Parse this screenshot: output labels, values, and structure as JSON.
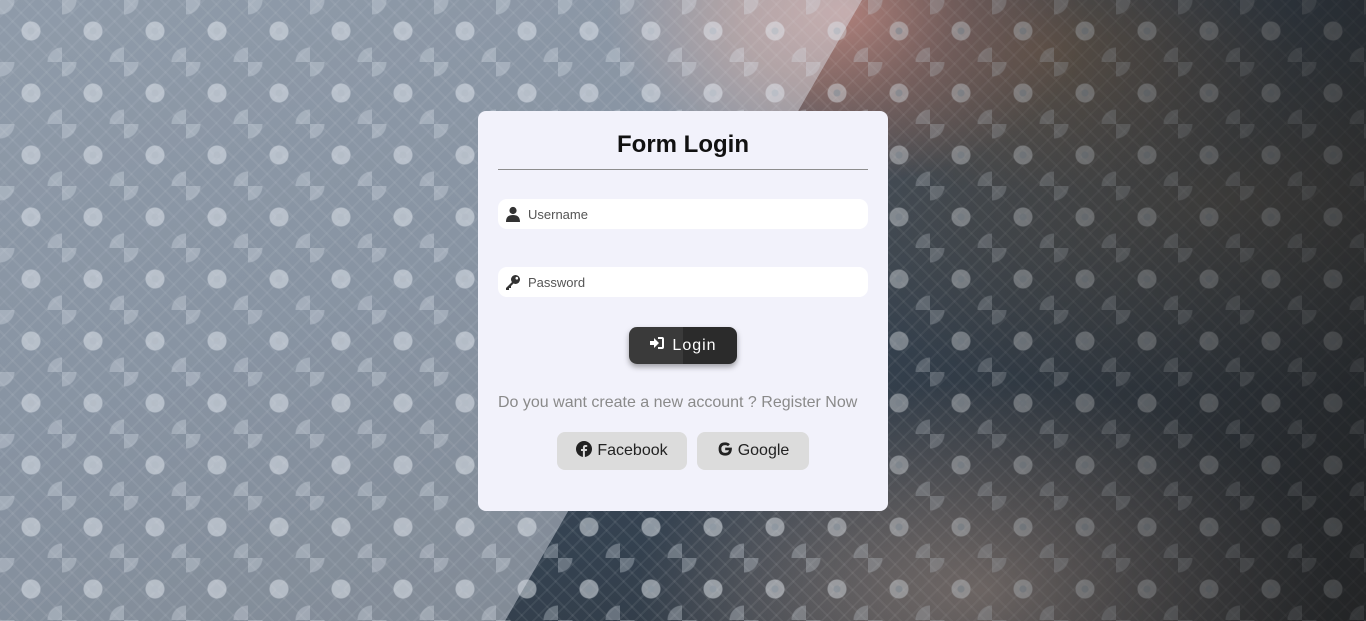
{
  "form": {
    "title": "Form Login",
    "username_placeholder": "Username",
    "password_placeholder": "Password",
    "login_label": "Login",
    "register_prompt": "Do you want create a new account ?",
    "register_link": "Register Now",
    "social": {
      "facebook_label": "Facebook",
      "google_label": "Google"
    }
  },
  "icons": {
    "username": "user-icon",
    "password": "key-icon",
    "login": "sign-in-icon",
    "facebook": "facebook-icon",
    "google": "google-icon"
  },
  "colors": {
    "card_background": "#f2f2fb",
    "login_button": "#333333",
    "social_button": "#dcdcdc",
    "muted_text": "#8a8a8a"
  }
}
